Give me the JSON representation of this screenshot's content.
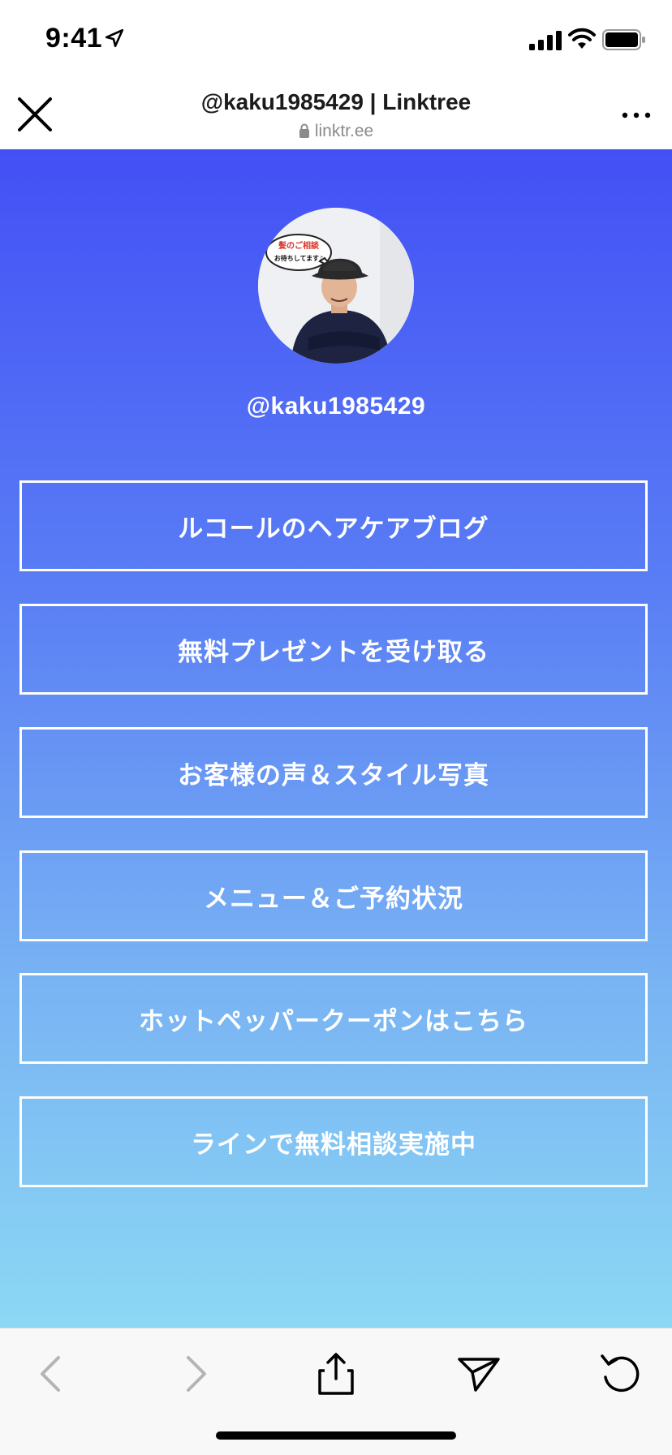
{
  "status_bar": {
    "time": "9:41",
    "icons": [
      "location-arrow-icon",
      "cellular-signal-icon",
      "wifi-icon",
      "battery-icon"
    ]
  },
  "nav": {
    "title": "@kaku1985429 | Linktree",
    "url": "linktr.ee",
    "close_icon": "close-icon",
    "more_icon": "more-icon",
    "lock_icon": "lock-icon"
  },
  "profile": {
    "username": "@kaku1985429",
    "avatar_bubble_line1": "髪のご相談",
    "avatar_bubble_line2": "お待ちしてます♪"
  },
  "links": [
    {
      "label": "ルコールのヘアケアブログ"
    },
    {
      "label": "無料プレゼントを受け取る"
    },
    {
      "label": "お客様の声＆スタイル写真"
    },
    {
      "label": "メニュー＆ご予約状況"
    },
    {
      "label": "ホットペッパークーポンはこちら"
    },
    {
      "label": "ラインで無料相談実施中"
    }
  ],
  "toolbar": {
    "icons": [
      "back-arrow-icon",
      "forward-arrow-icon",
      "share-icon",
      "send-icon",
      "reload-icon"
    ]
  },
  "colors": {
    "gradient_top": "#4350f5",
    "gradient_bottom": "#8cd8f4",
    "button_border": "#ffffff",
    "text_on_gradient": "#ffffff"
  }
}
